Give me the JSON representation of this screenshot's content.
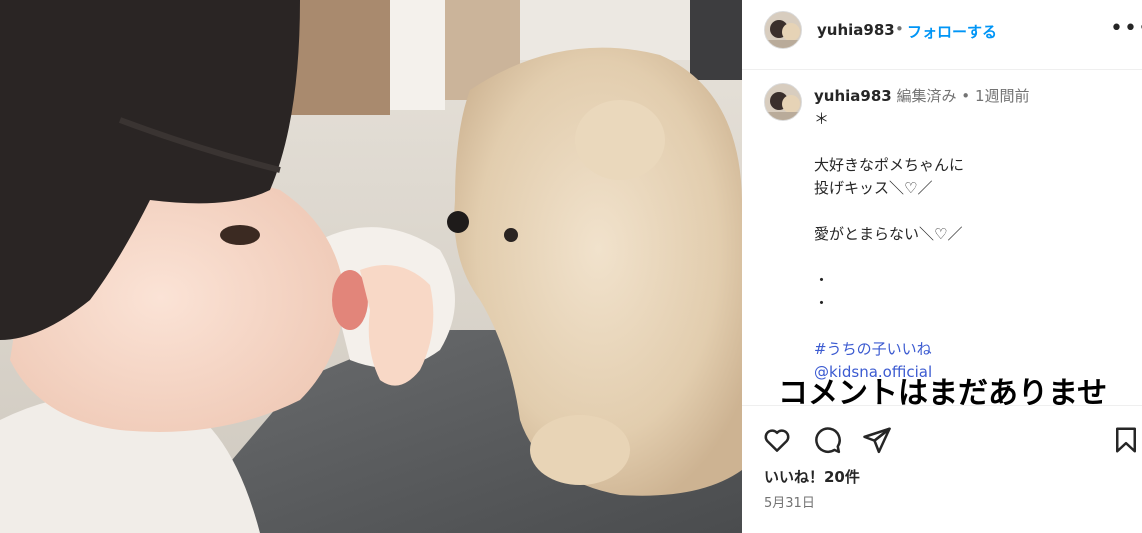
{
  "post": {
    "username": "yuhia983",
    "header_separator": "•",
    "follow_label": "フォローする",
    "more_icon": "more-options-icon",
    "more_glyph": "•••"
  },
  "caption": {
    "username": "yuhia983",
    "edited": "編集済み",
    "separator": "•",
    "time": "1週間前",
    "lines": [
      "＊",
      "",
      "大好きなポメちゃんに",
      "投げキッス＼♡／",
      "",
      "愛がとまらない＼♡／",
      "",
      "・",
      "・",
      ""
    ],
    "hashtag": "#うちの子いいね",
    "mention": "@kidsna.official"
  },
  "comments": {
    "empty_label": "コメントはまだありませ"
  },
  "actions": {
    "like_icon": "heart-icon",
    "comment_icon": "comment-icon",
    "share_icon": "share-icon",
    "save_icon": "bookmark-icon",
    "likes": "いいね！20件",
    "date": "5月31日"
  },
  "colors": {
    "link": "#0095f6",
    "hashtag": "#3c5bd1",
    "secondary_text": "#737373",
    "primary_text": "#262626"
  }
}
